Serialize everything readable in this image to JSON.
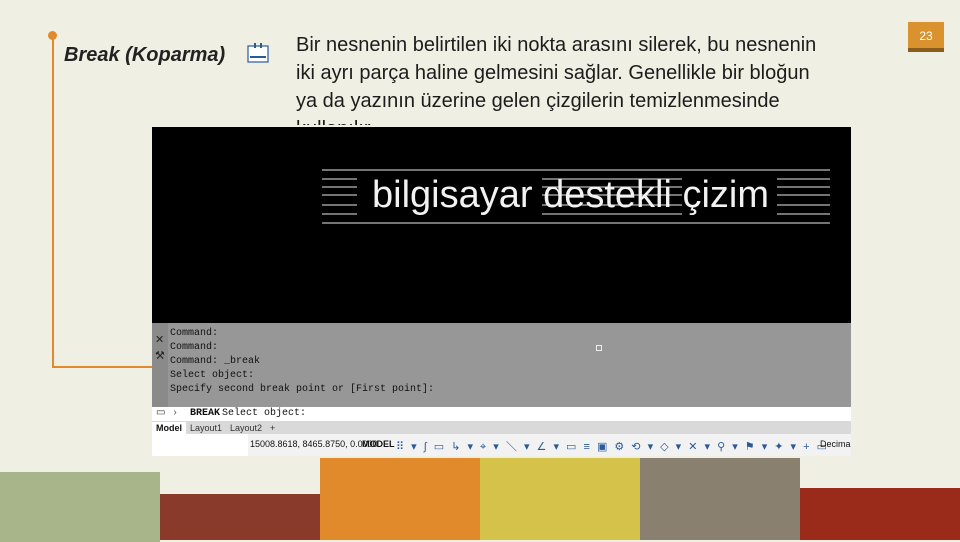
{
  "slide": {
    "title": "Break (Koparma)",
    "description": "Bir nesnenin belirtilen iki nokta arasını silerek, bu nesnenin iki ayrı parça haline gelmesini sağlar. Genellikle bir bloğun ya da yazının üzerine gelen çizgilerin temizlenmesinde kullanılır.",
    "page_number": "23"
  },
  "cad": {
    "drawing_text": "bilgisayar destekli çizim",
    "command_history": [
      "Command:",
      "Command:",
      "Command: _break",
      "Select object:",
      "Specify second break point or [First point]:"
    ],
    "command_input": {
      "name": "BREAK",
      "text": "Select object:"
    },
    "tabs": [
      "Model",
      "Layout1",
      "Layout2",
      "+"
    ],
    "active_tab": "Model",
    "status": {
      "coordinates": "15008.8618, 8465.8750, 0.0000",
      "space": "MODEL",
      "units": "Decimal"
    }
  },
  "colors": {
    "background": "#f0efe3",
    "accent": "#e08a2c",
    "page_badge": "#d9922e",
    "strip": [
      "#a8b58a",
      "#8a3a2a",
      "#e08a2c",
      "#d4c24a",
      "#8a8070",
      "#9a2a1a"
    ]
  },
  "icons": [
    "break-icon",
    "close-icon",
    "wrench-icon"
  ]
}
